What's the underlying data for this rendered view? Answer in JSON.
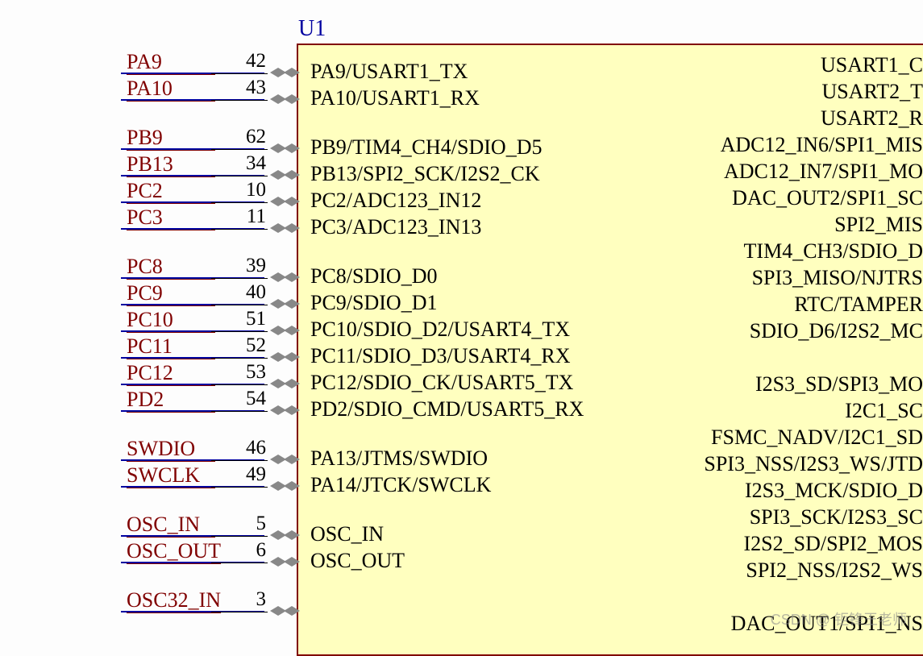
{
  "designator": "U1",
  "left_pins": [
    {
      "net": "PA9",
      "num": "42",
      "func": "PA9/USART1_TX"
    },
    {
      "net": "PA10",
      "num": "43",
      "func": "PA10/USART1_RX"
    },
    {
      "net": "PB9",
      "num": "62",
      "func": "PB9/TIM4_CH4/SDIO_D5"
    },
    {
      "net": "PB13",
      "num": "34",
      "func": "PB13/SPI2_SCK/I2S2_CK"
    },
    {
      "net": "PC2",
      "num": "10",
      "func": "PC2/ADC123_IN12"
    },
    {
      "net": "PC3",
      "num": "11",
      "func": "PC3/ADC123_IN13"
    },
    {
      "net": "PC8",
      "num": "39",
      "func": "PC8/SDIO_D0"
    },
    {
      "net": "PC9",
      "num": "40",
      "func": "PC9/SDIO_D1"
    },
    {
      "net": "PC10",
      "num": "51",
      "func": "PC10/SDIO_D2/USART4_TX"
    },
    {
      "net": "PC11",
      "num": "52",
      "func": "PC11/SDIO_D3/USART4_RX"
    },
    {
      "net": "PC12",
      "num": "53",
      "func": "PC12/SDIO_CK/USART5_TX"
    },
    {
      "net": "PD2",
      "num": "54",
      "func": "PD2/SDIO_CMD/USART5_RX"
    },
    {
      "net": "SWDIO",
      "num": "46",
      "func": "PA13/JTMS/SWDIO"
    },
    {
      "net": "SWCLK",
      "num": "49",
      "func": "PA14/JTCK/SWCLK"
    },
    {
      "net": "OSC_IN",
      "num": "5",
      "func": "OSC_IN"
    },
    {
      "net": "OSC_OUT",
      "num": "6",
      "func": "OSC_OUT"
    },
    {
      "net": "OSC32_IN",
      "num": "3",
      "func": ""
    }
  ],
  "right_funcs": [
    "USART1_C",
    "USART2_T",
    "USART2_R",
    "ADC12_IN6/SPI1_MIS",
    "ADC12_IN7/SPI1_MO",
    "DAC_OUT2/SPI1_SC",
    "SPI2_MIS",
    "TIM4_CH3/SDIO_D",
    "SPI3_MISO/NJTRS",
    "RTC/TAMPER",
    "SDIO_D6/I2S2_MC",
    "",
    "I2S3_SD/SPI3_MO",
    "I2C1_SC",
    "FSMC_NADV/I2C1_SD",
    "SPI3_NSS/I2S3_WS/JTD",
    "I2S3_MCK/SDIO_D",
    "SPI3_SCK/I2S3_SC",
    "I2S2_SD/SPI2_MOS",
    "SPI2_NSS/I2S2_WS",
    "",
    "DAC_OUT1/SPI1_NS"
  ],
  "watermark": "CSDN @ 钜锋王老师"
}
